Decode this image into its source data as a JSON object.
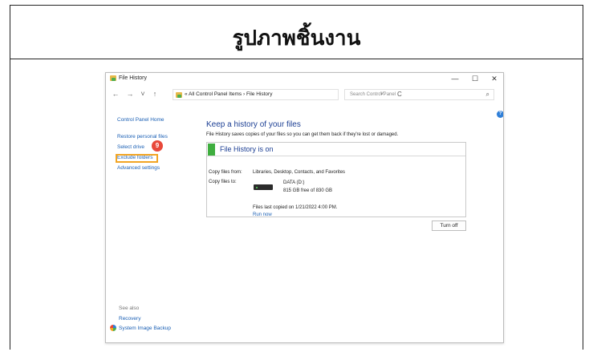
{
  "slide": {
    "title": "รูปภาพชิ้นงาน"
  },
  "window": {
    "title": "File History",
    "controls": {
      "minimize": "—",
      "maximize": "☐",
      "close": "✕"
    }
  },
  "nav": {
    "back": "←",
    "forward": "→",
    "recent": "˅",
    "up": "↑",
    "address": "« All Control Panel Items  ›  File History",
    "address_dropdown": "˅",
    "refresh": "C",
    "search_placeholder": "Search Control Panel",
    "search_icon": "⌕"
  },
  "help": "?",
  "sidebar": {
    "home": "Control Panel Home",
    "items": [
      "Restore personal files",
      "Select drive",
      "Exclude folders",
      "Advanced settings"
    ],
    "step_badge": "9",
    "see_also": "See also",
    "recovery": "Recovery",
    "system_image_backup": "System Image Backup"
  },
  "main": {
    "heading": "Keep a history of your files",
    "subtitle": "File History saves copies of your files so you can get them back if they're lost or damaged.",
    "status": "File History is on",
    "copy_from_label": "Copy files from:",
    "copy_from_value": "Libraries, Desktop, Contacts, and Favorites",
    "copy_to_label": "Copy files to:",
    "drive_name": "DATA (D:)",
    "drive_space": "815 GB free of 830 GB",
    "last_copied": "Files last copied on 1/21/2022 4:00 PM.",
    "run_now": "Run now",
    "turn_off": "Turn off"
  },
  "colors": {
    "accent_blue": "#1c3f94",
    "link_blue": "#1a5fb4",
    "status_green": "#3fae3f",
    "highlight": "#f2a524",
    "badge_red": "#e8493a"
  }
}
